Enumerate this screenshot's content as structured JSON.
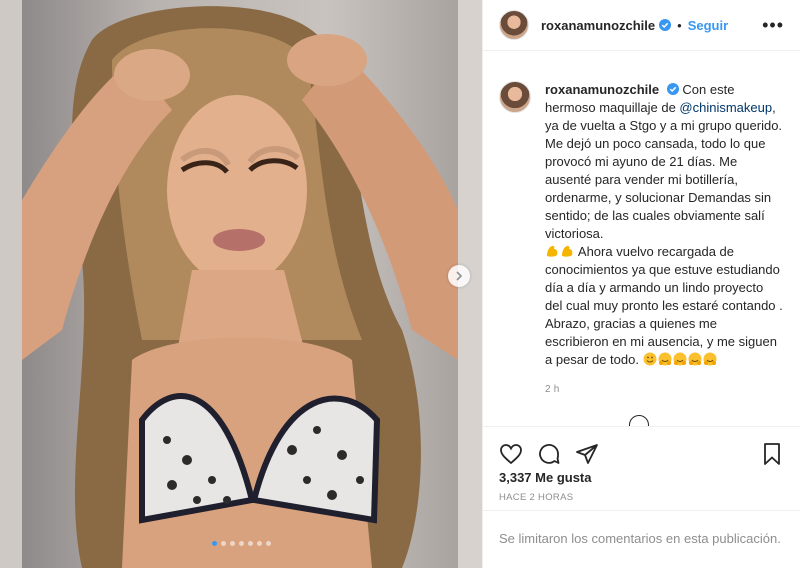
{
  "post": {
    "username": "roxanamunozchile",
    "separator": "•",
    "follow_label": "Seguir",
    "more_icon": "•••",
    "caption": {
      "username": "roxanamunozchile",
      "line_intro": "Con este hermoso maquillaje de",
      "mention": "@chinismakeup",
      "line_body": ", ya de vuelta a Stgo y a mi grupo querido. Me dejó un poco cansada, todo lo que provocó mi ayuno de 21 días. Me ausenté para vender mi botillería, ordenarme, y solucionar Demandas sin sentido; de las cuales obviamente salí victoriosa.",
      "line_after_emoji": "Ahora vuelvo recargada de conocimientos ya que estuve estudiando día a día y armando un lindo proyecto del cual muy pronto les estaré contando . Abrazo, gracias a quienes me escribieron en mi ausencia, y me siguen a pesar de todo."
    },
    "comment_time": "2 h",
    "likes": "3,337 Me gusta",
    "posted_ago": "HACE 2 HORAS",
    "comments_limited": "Se limitaron los comentarios en esta publicación.",
    "carousel": {
      "total_slides": 7,
      "active_index": 0
    },
    "icons": {
      "verified": "verified-badge-icon",
      "like": "heart-icon",
      "comment": "comment-icon",
      "share": "share-icon",
      "save": "bookmark-icon",
      "next": "chevron-right-icon",
      "load_more": "plus-circle-icon",
      "emoji_muscle": "flexed-bicep-emoji",
      "emoji_smile": "smiling-face-emoji",
      "emoji_hug": "hugging-face-emoji"
    },
    "colors": {
      "accent": "#3897f0",
      "text": "#262626",
      "muted": "#8e8e8e",
      "mention": "#00376b"
    }
  }
}
